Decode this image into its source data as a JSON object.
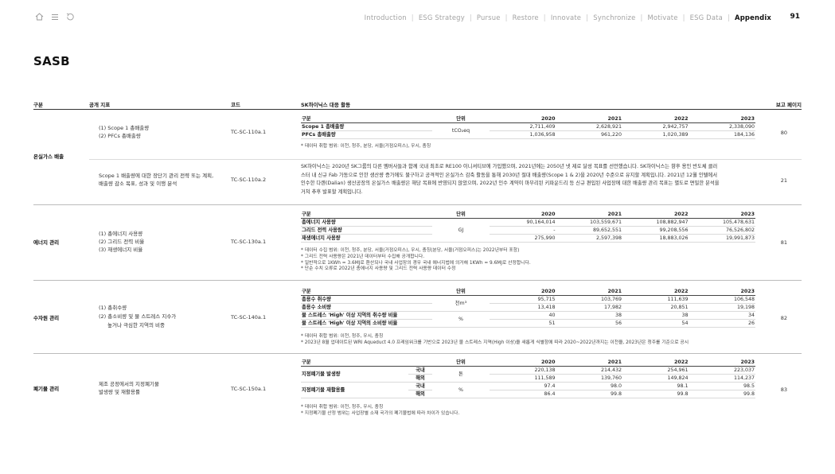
{
  "nav": {
    "items": [
      "Introduction",
      "ESG Strategy",
      "Pursue",
      "Restore",
      "Innovate",
      "Synchronize",
      "Motivate",
      "ESG Data",
      "Appendix"
    ],
    "active": "Appendix",
    "page_number": "91"
  },
  "page_title": "SASB",
  "header": {
    "col_category": "구분",
    "col_indicator": "공개 지표",
    "col_code": "코드",
    "col_response": "SK하이닉스 대응 활동",
    "col_page": "보고 페이지"
  },
  "ghg": {
    "category": "온실가스 배출",
    "row1": {
      "indicator_l1": "(1) Scope 1 총배출량",
      "indicator_l2": "(2) PFCs 총배출량",
      "code": "TC-SC-110a.1",
      "page": "80",
      "table": {
        "headers": [
          "구분",
          "단위",
          "2020",
          "2021",
          "2022",
          "2023"
        ],
        "unit": "tCO₂eq",
        "rows": [
          {
            "label": "Scope 1 총배출량",
            "values": [
              "2,711,409",
              "2,628,921",
              "2,942,757",
              "2,338,090"
            ]
          },
          {
            "label": "PFCs 총배출량",
            "values": [
              "1,036,958",
              "961,220",
              "1,020,389",
              "184,136"
            ]
          }
        ]
      },
      "notes": [
        "* 데이터 취합 범위: 이천, 청주, 분당, 서울(거점오피스), 우시, 충칭"
      ]
    },
    "row2": {
      "indicator_l1": "Scope 1 배출량에 대한 장단기 관리 전략 또는 계획,",
      "indicator_l2": "배출량 감소 목표, 성과 및 이행 분석",
      "code": "TC-SC-110a.2",
      "page": "21",
      "para_l1": "SK하이닉스는 2020년 SK그룹의 다른 멤버사들과 함께 국내 최초로 RE100 이니셔티브에 가입했으며, 2021년에는 2050년 넷 제로 달성 목표를 선언했습니다. SK하이닉스는 향후 용인 반도체 클러",
      "para_l2": "스터 내 신규 Fab 가동으로 인한 생산량 증가에도 불구하고 공격적인 온실가스 감축 활동을 통해 2030년 절대 배출량(Scope 1 & 2)을 2020년 수준으로 유지할 계획입니다. 2021년 12월 인텔에서",
      "para_l3": "인수한 다롄(Dalian) 생산공장의 온실가스 배출량은 해당 목표에 반영되지 않았으며, 2022년 인수 계약이 마무리된 키파운드리 등 신규 편입된 사업장에 대한 배출량 관리 목표는 별도로 면밀한 분석을",
      "para_l4": "거쳐 추후 발표할 계획입니다."
    }
  },
  "energy": {
    "category": "에너지 관리",
    "indicator_l1": "(1) 총에너지 사용량",
    "indicator_l2": "(2) 그리드 전력 비율",
    "indicator_l3": "(3) 재생에너지 비율",
    "code": "TC-SC-130a.1",
    "page": "81",
    "table": {
      "headers": [
        "구분",
        "단위",
        "2020",
        "2021",
        "2022",
        "2023"
      ],
      "unit": "GJ",
      "rows": [
        {
          "label": "총에너지 사용량",
          "values": [
            "90,164,014",
            "103,559,671",
            "108,882,947",
            "105,478,631"
          ]
        },
        {
          "label": "그리드 전력 사용량",
          "values": [
            "-",
            "89,652,551",
            "99,208,556",
            "76,526,802"
          ]
        },
        {
          "label": "재생에너지 사용량",
          "values": [
            "275,990",
            "2,597,398",
            "18,883,026",
            "19,991,873"
          ]
        }
      ]
    },
    "notes": [
      "* 데이터 수집 범위: 이천, 청주, 분당, 서울(거점오피스), 우시, 충칭(분당, 서울(거점오피스)는 2022년부터 포함)",
      "* 그리드 전력 사용량은 2021년 데이터부터 수집해 공개합니다.",
      "* 일반적으로 1KWh = 3.6MJ로 환산되나 국내 사업장의 경우 국내 에너지법에 의거해 1KWh = 9.6MJ로 산정합니다.",
      "* 단순 수치 오류로 2022년 총에너지 사용량 및 그리드 전력 사용량 데이터 수정"
    ]
  },
  "water": {
    "category": "수자원 관리",
    "indicator_l1": "(1) 총취수량",
    "indicator_l2": "(2) 총소비량 및 물 스트레스 지수가",
    "indicator_l3": "높거나 극심한 지역의 비중",
    "code": "TC-SC-140a.1",
    "page": "82",
    "table": {
      "headers": [
        "구분",
        "단위",
        "2020",
        "2021",
        "2022",
        "2023"
      ],
      "unit_volume": "천m³",
      "unit_pct": "%",
      "rows": [
        {
          "label": "총용수 취수량",
          "values": [
            "95,715",
            "103,769",
            "111,639",
            "106,548"
          ]
        },
        {
          "label": "총용수 소비량",
          "values": [
            "13,418",
            "17,982",
            "20,851",
            "19,198"
          ]
        },
        {
          "label": "물 스트레스 'High' 이상 지역의 취수량 비율",
          "values": [
            "40",
            "38",
            "38",
            "34"
          ]
        },
        {
          "label": "물 스트레스 'High' 이상 지역의 소비량 비율",
          "values": [
            "51",
            "56",
            "54",
            "26"
          ]
        }
      ]
    },
    "notes": [
      "* 데이터 취합 범위: 이천, 청주, 우시, 충칭",
      "* 2023년 8월 업데이트된 WRI Aqueduct 4.0 프레임워크를 기반으로 2023년 물 스트레스 지역(High 이상)을 새롭게 식별함에 따라 2020~2022년까지는 이천을, 2023년은 청주를 기준으로 공시"
    ]
  },
  "waste": {
    "category": "폐기물 관리",
    "indicator_l1": "제조 공정에서의 지정폐기물",
    "indicator_l2": "발생량 및 재활용률",
    "code": "TC-SC-150a.1",
    "page": "83",
    "table": {
      "headers": [
        "구분",
        "",
        "단위",
        "2020",
        "2021",
        "2022",
        "2023"
      ],
      "group1": "지정폐기물 발생량",
      "group1_unit": "톤",
      "group2": "지정폐기물 재활용률",
      "group2_unit": "%",
      "rows": [
        {
          "sub": "국내",
          "values": [
            "220,138",
            "214,432",
            "254,961",
            "223,037"
          ]
        },
        {
          "sub": "해외",
          "values": [
            "111,589",
            "139,760",
            "149,824",
            "114,237"
          ]
        },
        {
          "sub": "국내",
          "values": [
            "97.4",
            "98.0",
            "98.1",
            "98.5"
          ]
        },
        {
          "sub": "해외",
          "values": [
            "86.4",
            "99.8",
            "99.8",
            "99.8"
          ]
        }
      ]
    },
    "notes": [
      "* 데이터 취합 범위: 이천, 청주, 우시, 충칭",
      "* 지정폐기물 산정 범위는 사업장별 소재 국가의 폐기물법에 따라 차이가 있습니다."
    ]
  }
}
